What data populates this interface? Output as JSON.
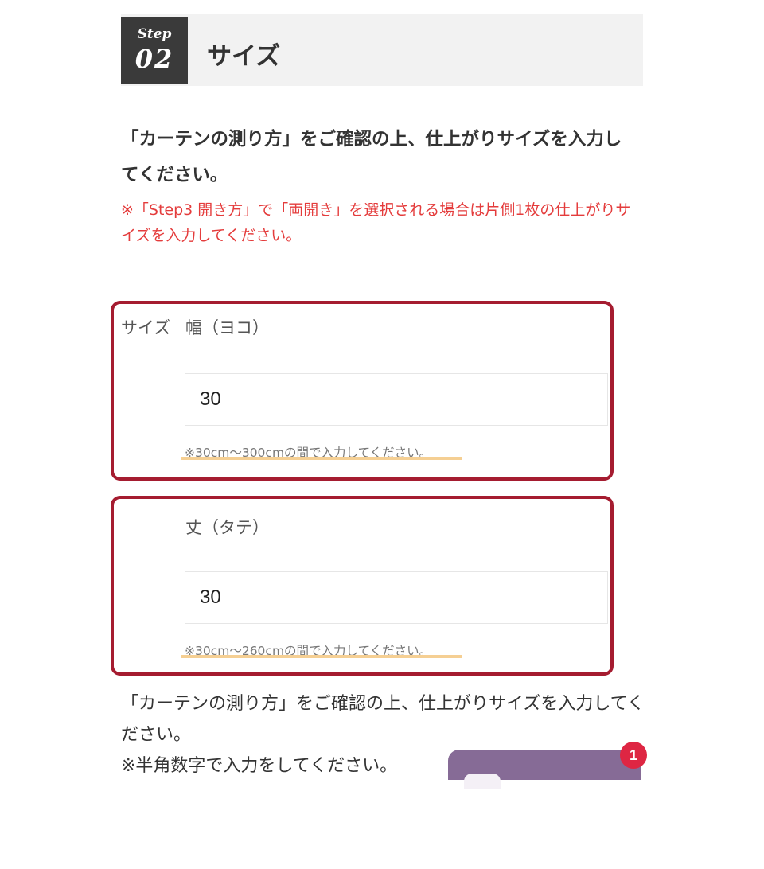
{
  "step": {
    "word": "Step",
    "number": "02",
    "title": "サイズ"
  },
  "intro": {
    "text": "「カーテンの測り方」をご確認の上、仕上がりサイズを入力してください。",
    "notice": "※「Step3 開き方」で「両開き」を選択される場合は片側1枚の仕上がりサイズを入力してください。"
  },
  "size_section": {
    "label": "サイズ"
  },
  "width_field": {
    "label": "幅（ヨコ）",
    "value": "30",
    "hint": "※30cm〜300cmの間で入力してください。"
  },
  "height_field": {
    "label": "丈（タテ）",
    "value": "30",
    "hint": "※30cm〜260cmの間で入力してください。"
  },
  "footer": {
    "line1": "「カーテンの測り方」をご確認の上、仕上がりサイズを入力してください。",
    "line2": "※半角数字で入力をしてください。"
  },
  "chat": {
    "badge_count": "1",
    "icon": "chat-icon"
  },
  "colors": {
    "accent_border": "#a51c30",
    "notice_red": "#e43c3c",
    "hint_underline": "#f5cf93",
    "chat_purple": "#866b96",
    "badge_red": "#de2643"
  }
}
